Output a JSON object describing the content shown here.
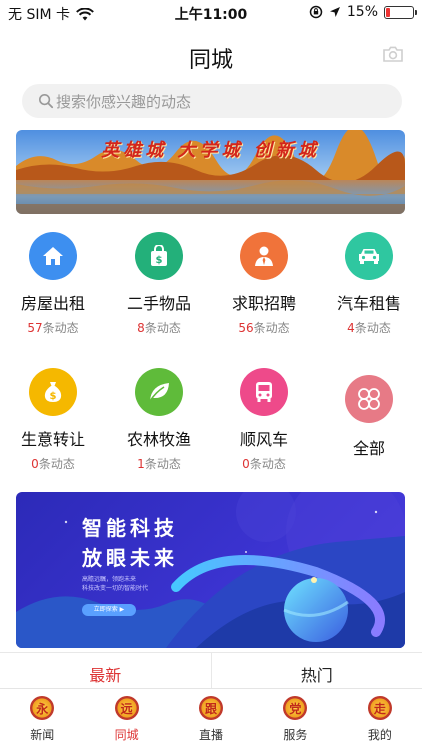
{
  "status_bar": {
    "carrier": "无 SIM 卡",
    "time": "上午11:00",
    "battery": "15%",
    "battery_level": 0.15
  },
  "header": {
    "title": "同城",
    "camera_icon": "camera-icon"
  },
  "search": {
    "placeholder": "搜索你感兴趣的动态",
    "icon": "search-icon"
  },
  "banner": {
    "text": "英雄城 大学城 创新城"
  },
  "categories": [
    {
      "name": "房屋出租",
      "count": "57",
      "suffix": "条动态",
      "icon": "house-icon",
      "color": "#3d8ff0"
    },
    {
      "name": "二手物品",
      "count": "8",
      "suffix": "条动态",
      "icon": "shopping-bag-icon",
      "color": "#23b07a"
    },
    {
      "name": "求职招聘",
      "count": "56",
      "suffix": "条动态",
      "icon": "person-tie-icon",
      "color": "#f0733a"
    },
    {
      "name": "汽车租售",
      "count": "4",
      "suffix": "条动态",
      "icon": "car-icon",
      "color": "#2fc7a0"
    },
    {
      "name": "生意转让",
      "count": "0",
      "suffix": "条动态",
      "icon": "money-bag-icon",
      "color": "#f5b800"
    },
    {
      "name": "农林牧渔",
      "count": "1",
      "suffix": "条动态",
      "icon": "leaf-icon",
      "color": "#5fbb3a"
    },
    {
      "name": "顺风车",
      "count": "0",
      "suffix": "条动态",
      "icon": "bus-icon",
      "color": "#ee4a8a"
    },
    {
      "name": "全部",
      "icon": "grid-icon",
      "color": "#e77a86"
    }
  ],
  "promo": {
    "line1": "智能科技",
    "line2": "放眼未来",
    "sub1": "高瞻远瞩，领跑未来",
    "sub2": "科技改变一切的智能时代",
    "button": "立即探索 ▶"
  },
  "segment": {
    "tabs": [
      "最新",
      "热门"
    ],
    "active": "最新"
  },
  "tabbar": {
    "items": [
      {
        "glyph": "永",
        "label": "新闻"
      },
      {
        "glyph": "远",
        "label": "同城"
      },
      {
        "glyph": "跟",
        "label": "直播"
      },
      {
        "glyph": "党",
        "label": "服务"
      },
      {
        "glyph": "走",
        "label": "我的"
      }
    ],
    "active": "同城"
  }
}
